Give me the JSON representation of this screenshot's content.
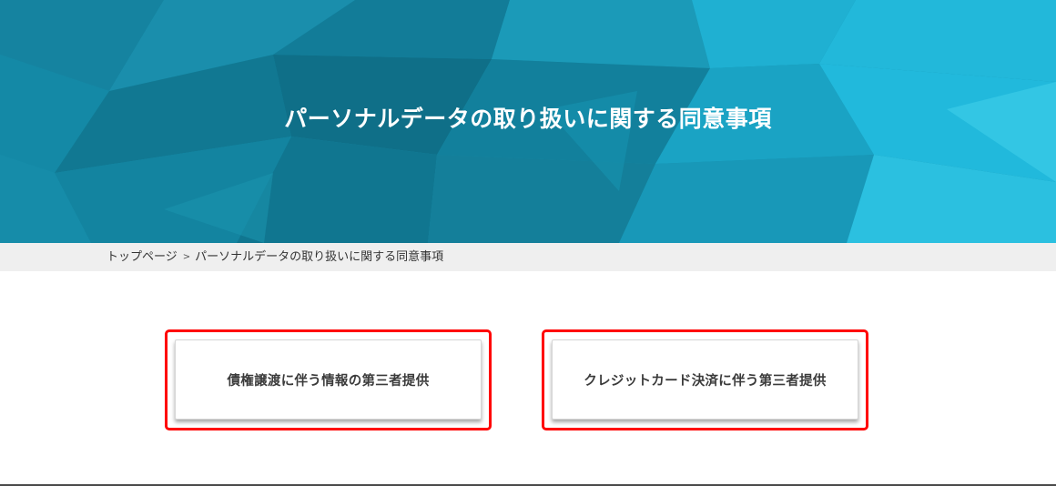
{
  "hero": {
    "title": "パーソナルデータの取り扱いに関する同意事項"
  },
  "breadcrumb": {
    "items": [
      {
        "label": "トップページ"
      },
      {
        "label": "パーソナルデータの取り扱いに関する同意事項"
      }
    ],
    "separator": ">"
  },
  "cards": [
    {
      "label": "債権譲渡に伴う情報の第三者提供"
    },
    {
      "label": "クレジットカード決済に伴う第三者提供"
    }
  ],
  "colors": {
    "hero_primary": "#1aa6c4",
    "highlight_border": "#ff0000",
    "breadcrumb_bg": "#efefef"
  }
}
